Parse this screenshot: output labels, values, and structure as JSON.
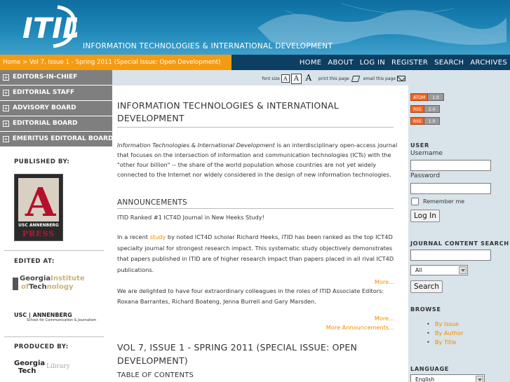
{
  "header": {
    "logo_text": "ITID",
    "site_title": "INFORMATION TECHNOLOGIES & INTERNATIONAL DEVELOPMENT"
  },
  "nav": {
    "breadcrumb": "Home > Vol 7, Issue 1 - Spring 2011 (Special Issue: Open Development)",
    "items": [
      "HOME",
      "ABOUT",
      "LOG IN",
      "REGISTER",
      "SEARCH",
      "ARCHIVES"
    ]
  },
  "left": {
    "accordion": [
      "EDITORS-IN-CHIEF",
      "EDITORIAL STAFF",
      "ADVISORY BOARD",
      "EDITORIAL BOARD",
      "EMERITUS EDITORAL BOARD"
    ],
    "published_by": "PUBLISHED BY:",
    "press_top": "USC ANNENBERG",
    "press_bottom": "PRESS",
    "edited_at": "EDITED AT:",
    "gt_line1_a": "Georgia",
    "gt_line1_b": "Institute",
    "gt_line2_a": "of",
    "gt_line2_b": "Tech",
    "gt_line2_c": "nology",
    "usc_line1": "USC | ANNENBERG",
    "usc_line2": "School for Communication & Journalism",
    "produced_by": "PRODUCED BY:",
    "lib_line1": "Georgia",
    "lib_line2": "Tech",
    "lib_word": "Library"
  },
  "toolbar": {
    "font_size_label": "font size",
    "font_a": "A",
    "print_label": "print this page",
    "email_label": "email this page"
  },
  "main": {
    "title": "INFORMATION TECHNOLOGIES & INTERNATIONAL DEVELOPMENT",
    "desc_italic": "Information Technologies & International Development",
    "desc_rest": " is an interdisciplinary open-access journal that focuses on the intersection of information and communication technologies (ICTs) with the \"other four billion\" -- the share of the world population whose countries are not yet widely connected to the Internet nor widely considered in the design of new information technologies.",
    "announcements_heading": "ANNOUNCEMENTS",
    "ann1_title": "ITID Ranked #1 ICT4D Journal in New Heeks Study!",
    "ann1_pre": "In a recent ",
    "ann1_link": "study",
    "ann1_mid": " by noted ICT4D scholar Richard Heeks, ",
    "ann1_itid": "ITID",
    "ann1_post": " has been ranked as the top ICT4D specialty journal for strongest research impact.  This systematic study objectively demonstrates that papers published in ITID are of higher research impact than papers placed in all rival ICT4D publications.",
    "more": "More...",
    "ann2_text": "We are delighted to have four extraordinary colleagues in the roles of ITID Associate Editors: Roxana Barrantes, Richard Boateng, Jenna Burrell and Gary Marsden.",
    "more_announcements": "More Announcements...",
    "volume_heading": "VOL 7, ISSUE 1 - SPRING 2011 (SPECIAL ISSUE: OPEN DEVELOPMENT)",
    "toc_heading": "TABLE OF CONTENTS"
  },
  "right": {
    "feeds": [
      {
        "name": "ATOM",
        "version": "1.0"
      },
      {
        "name": "RSS",
        "version": "2.0"
      },
      {
        "name": "RSS",
        "version": "1.0"
      }
    ],
    "user_heading": "USER",
    "username_label": "Username",
    "password_label": "Password",
    "remember_label": "Remember me",
    "login_button": "Log In",
    "search_heading": "JOURNAL CONTENT SEARCH",
    "search_scope": "All",
    "search_button": "Search",
    "browse_heading": "BROWSE",
    "browse_items": [
      "By Issue",
      "By Author",
      "By Title"
    ],
    "language_heading": "LANGUAGE",
    "language_value": "English"
  }
}
